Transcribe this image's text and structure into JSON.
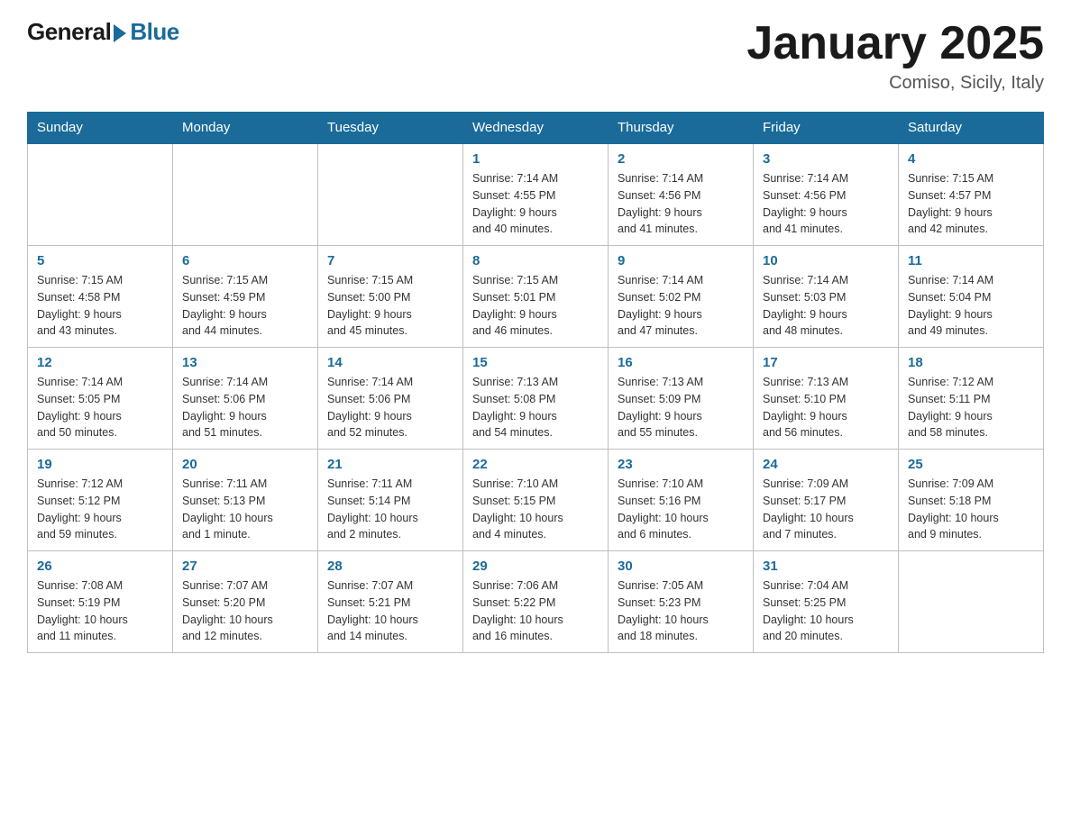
{
  "logo": {
    "general": "General",
    "blue": "Blue",
    "tagline": "GeneralBlue"
  },
  "header": {
    "title": "January 2025",
    "location": "Comiso, Sicily, Italy"
  },
  "weekdays": [
    "Sunday",
    "Monday",
    "Tuesday",
    "Wednesday",
    "Thursday",
    "Friday",
    "Saturday"
  ],
  "weeks": [
    [
      {
        "day": "",
        "info": ""
      },
      {
        "day": "",
        "info": ""
      },
      {
        "day": "",
        "info": ""
      },
      {
        "day": "1",
        "info": "Sunrise: 7:14 AM\nSunset: 4:55 PM\nDaylight: 9 hours\nand 40 minutes."
      },
      {
        "day": "2",
        "info": "Sunrise: 7:14 AM\nSunset: 4:56 PM\nDaylight: 9 hours\nand 41 minutes."
      },
      {
        "day": "3",
        "info": "Sunrise: 7:14 AM\nSunset: 4:56 PM\nDaylight: 9 hours\nand 41 minutes."
      },
      {
        "day": "4",
        "info": "Sunrise: 7:15 AM\nSunset: 4:57 PM\nDaylight: 9 hours\nand 42 minutes."
      }
    ],
    [
      {
        "day": "5",
        "info": "Sunrise: 7:15 AM\nSunset: 4:58 PM\nDaylight: 9 hours\nand 43 minutes."
      },
      {
        "day": "6",
        "info": "Sunrise: 7:15 AM\nSunset: 4:59 PM\nDaylight: 9 hours\nand 44 minutes."
      },
      {
        "day": "7",
        "info": "Sunrise: 7:15 AM\nSunset: 5:00 PM\nDaylight: 9 hours\nand 45 minutes."
      },
      {
        "day": "8",
        "info": "Sunrise: 7:15 AM\nSunset: 5:01 PM\nDaylight: 9 hours\nand 46 minutes."
      },
      {
        "day": "9",
        "info": "Sunrise: 7:14 AM\nSunset: 5:02 PM\nDaylight: 9 hours\nand 47 minutes."
      },
      {
        "day": "10",
        "info": "Sunrise: 7:14 AM\nSunset: 5:03 PM\nDaylight: 9 hours\nand 48 minutes."
      },
      {
        "day": "11",
        "info": "Sunrise: 7:14 AM\nSunset: 5:04 PM\nDaylight: 9 hours\nand 49 minutes."
      }
    ],
    [
      {
        "day": "12",
        "info": "Sunrise: 7:14 AM\nSunset: 5:05 PM\nDaylight: 9 hours\nand 50 minutes."
      },
      {
        "day": "13",
        "info": "Sunrise: 7:14 AM\nSunset: 5:06 PM\nDaylight: 9 hours\nand 51 minutes."
      },
      {
        "day": "14",
        "info": "Sunrise: 7:14 AM\nSunset: 5:06 PM\nDaylight: 9 hours\nand 52 minutes."
      },
      {
        "day": "15",
        "info": "Sunrise: 7:13 AM\nSunset: 5:08 PM\nDaylight: 9 hours\nand 54 minutes."
      },
      {
        "day": "16",
        "info": "Sunrise: 7:13 AM\nSunset: 5:09 PM\nDaylight: 9 hours\nand 55 minutes."
      },
      {
        "day": "17",
        "info": "Sunrise: 7:13 AM\nSunset: 5:10 PM\nDaylight: 9 hours\nand 56 minutes."
      },
      {
        "day": "18",
        "info": "Sunrise: 7:12 AM\nSunset: 5:11 PM\nDaylight: 9 hours\nand 58 minutes."
      }
    ],
    [
      {
        "day": "19",
        "info": "Sunrise: 7:12 AM\nSunset: 5:12 PM\nDaylight: 9 hours\nand 59 minutes."
      },
      {
        "day": "20",
        "info": "Sunrise: 7:11 AM\nSunset: 5:13 PM\nDaylight: 10 hours\nand 1 minute."
      },
      {
        "day": "21",
        "info": "Sunrise: 7:11 AM\nSunset: 5:14 PM\nDaylight: 10 hours\nand 2 minutes."
      },
      {
        "day": "22",
        "info": "Sunrise: 7:10 AM\nSunset: 5:15 PM\nDaylight: 10 hours\nand 4 minutes."
      },
      {
        "day": "23",
        "info": "Sunrise: 7:10 AM\nSunset: 5:16 PM\nDaylight: 10 hours\nand 6 minutes."
      },
      {
        "day": "24",
        "info": "Sunrise: 7:09 AM\nSunset: 5:17 PM\nDaylight: 10 hours\nand 7 minutes."
      },
      {
        "day": "25",
        "info": "Sunrise: 7:09 AM\nSunset: 5:18 PM\nDaylight: 10 hours\nand 9 minutes."
      }
    ],
    [
      {
        "day": "26",
        "info": "Sunrise: 7:08 AM\nSunset: 5:19 PM\nDaylight: 10 hours\nand 11 minutes."
      },
      {
        "day": "27",
        "info": "Sunrise: 7:07 AM\nSunset: 5:20 PM\nDaylight: 10 hours\nand 12 minutes."
      },
      {
        "day": "28",
        "info": "Sunrise: 7:07 AM\nSunset: 5:21 PM\nDaylight: 10 hours\nand 14 minutes."
      },
      {
        "day": "29",
        "info": "Sunrise: 7:06 AM\nSunset: 5:22 PM\nDaylight: 10 hours\nand 16 minutes."
      },
      {
        "day": "30",
        "info": "Sunrise: 7:05 AM\nSunset: 5:23 PM\nDaylight: 10 hours\nand 18 minutes."
      },
      {
        "day": "31",
        "info": "Sunrise: 7:04 AM\nSunset: 5:25 PM\nDaylight: 10 hours\nand 20 minutes."
      },
      {
        "day": "",
        "info": ""
      }
    ]
  ]
}
